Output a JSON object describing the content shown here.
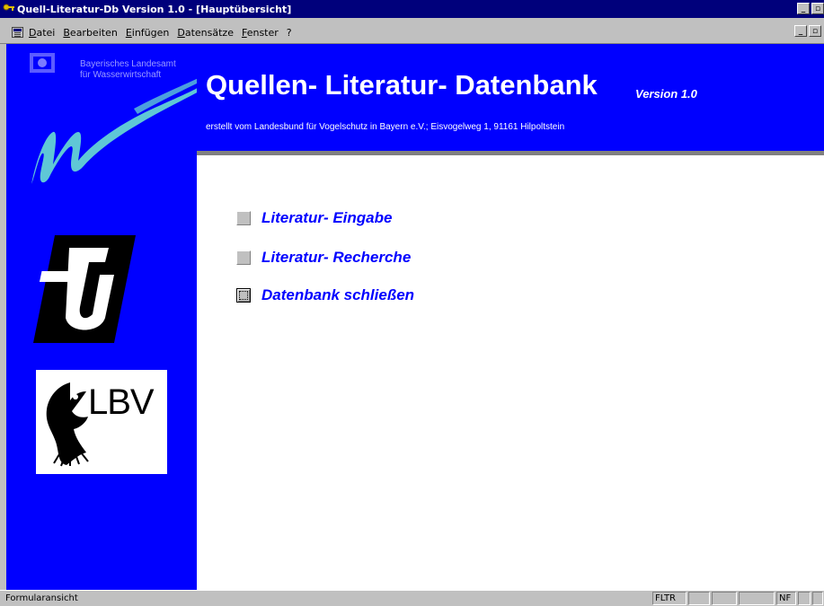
{
  "window": {
    "title": "Quell-Literatur-Db Version 1.0 - [Hauptübersicht]",
    "controls": [
      "_",
      "▫"
    ]
  },
  "menubar": {
    "items": [
      {
        "label": "Datei"
      },
      {
        "label": "Bearbeiten"
      },
      {
        "label": "Einfügen"
      },
      {
        "label": "Datensätze"
      },
      {
        "label": "Fenster"
      },
      {
        "label": "?"
      }
    ]
  },
  "sidebar": {
    "lfw_line1": "Bayerisches Landesamt",
    "lfw_line2": "für Wasserwirtschaft",
    "lbv_text": "LBV"
  },
  "header": {
    "title": "Quellen- Literatur- Datenbank",
    "version": "Version 1.0",
    "subtitle": "erstellt vom Landesbund für Vogelschutz in Bayern e.V.; Eisvogelweg 1, 91161 Hilpoltstein"
  },
  "main_menu": {
    "items": [
      {
        "label": "Literatur- Eingabe"
      },
      {
        "label": "Literatur- Recherche"
      },
      {
        "label": "Datenbank schließen"
      }
    ]
  },
  "statusbar": {
    "text": "Formularansicht",
    "panels": [
      "FLTR",
      "",
      "",
      "",
      "NF",
      "",
      ""
    ]
  },
  "colors": {
    "accent_blue": "#0000ff",
    "titlebar": "#00007b",
    "logo_cyan": "#5fc7d6",
    "chrome_gray": "#c0c0c0"
  }
}
